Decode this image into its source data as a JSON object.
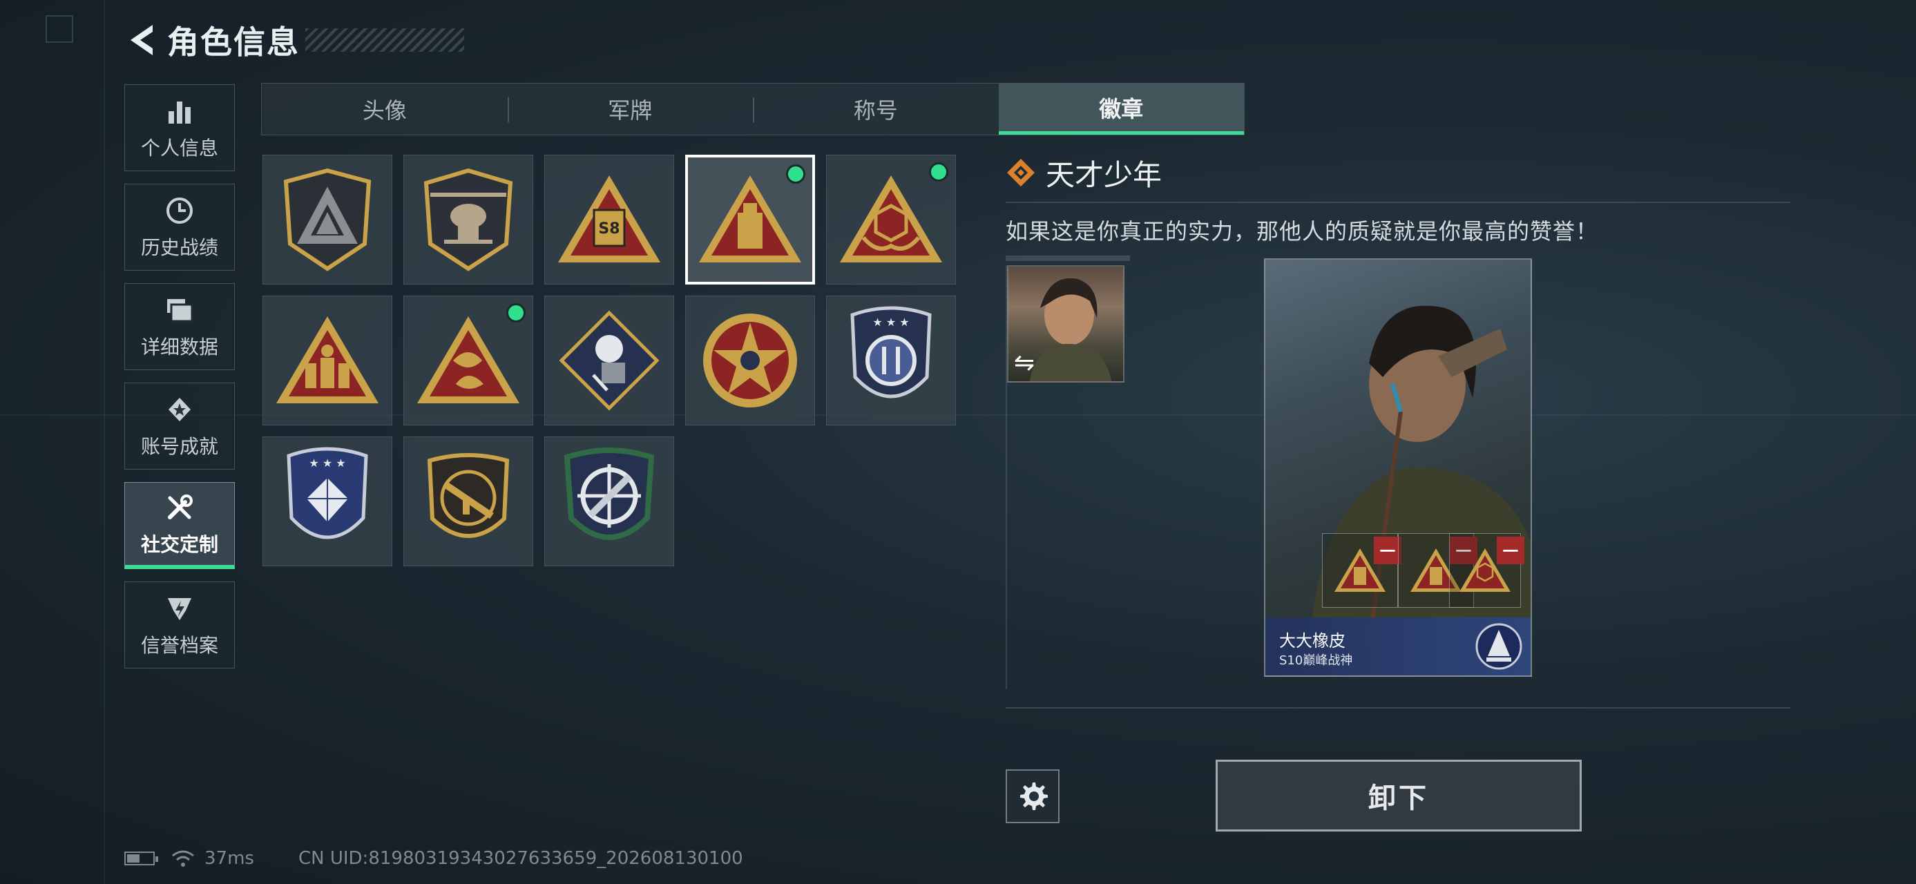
{
  "header": {
    "title": "角色信息"
  },
  "nav": [
    {
      "label": "个人信息",
      "icon": "bar-chart-icon"
    },
    {
      "label": "历史战绩",
      "icon": "history-clock-icon"
    },
    {
      "label": "详细数据",
      "icon": "folder-data-icon"
    },
    {
      "label": "账号成就",
      "icon": "achievement-star-icon"
    },
    {
      "label": "社交定制",
      "icon": "wrench-tools-icon",
      "active": true
    },
    {
      "label": "信誉档案",
      "icon": "credit-shield-icon"
    }
  ],
  "tabs": [
    {
      "label": "头像"
    },
    {
      "label": "军牌"
    },
    {
      "label": "称号"
    },
    {
      "label": "徽章",
      "active": true
    }
  ],
  "badges": [
    {
      "icon": "triangle-shield-badge"
    },
    {
      "icon": "helicopter-badge"
    },
    {
      "icon": "s8-tower-badge"
    },
    {
      "icon": "usb-triangle-badge",
      "selected": true,
      "equipped": true
    },
    {
      "icon": "hands-dice-badge",
      "equipped": true
    },
    {
      "icon": "soldiers-triangle-badge"
    },
    {
      "icon": "fish-triangle-badge",
      "equipped": true
    },
    {
      "icon": "rose-fist-badge"
    },
    {
      "icon": "star-round-badge"
    },
    {
      "icon": "blue-shield-badge"
    },
    {
      "icon": "diamond-wreath-badge"
    },
    {
      "icon": "rifle-shield-badge"
    },
    {
      "icon": "crosshair-knife-badge"
    }
  ],
  "detail": {
    "name": "天才少年",
    "description": "如果这是你真正的实力，那他人的质疑就是你最高的赞誉！",
    "swap_label": "⇋",
    "card": {
      "player_name": "大大橡皮",
      "rank": "S10巅峰战神",
      "slots": [
        "usb-triangle-badge",
        "usb-triangle-badge",
        "hands-dice-badge"
      ]
    },
    "unequip_label": "卸下"
  },
  "status": {
    "ping": "37ms",
    "uid": "CN UID:8198031934302763365​9_202608130100"
  },
  "colors": {
    "accent": "#3ddc97",
    "badge_gold": "#c9a24a",
    "badge_red": "#8c2424",
    "badge_navy": "#25314e",
    "minus_red": "#a52a2a"
  }
}
